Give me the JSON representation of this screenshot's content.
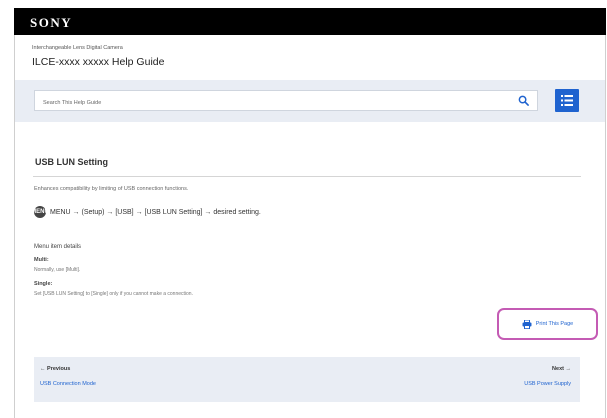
{
  "header": {
    "logo": "SONY"
  },
  "product": {
    "line": "Interchangeable Lens Digital Camera",
    "guide_title": "ILCE-xxxx xxxxx Help Guide"
  },
  "search": {
    "placeholder": "Search This Help Guide",
    "value": ""
  },
  "page": {
    "heading": "USB LUN Setting",
    "description": "Enhances compatibility by limiting of USB connection functions.",
    "menu_icon_label": "MENU",
    "menu_path": "MENU → (Setup) → [USB] → [USB LUN Setting] → desired setting."
  },
  "details": {
    "heading": "Menu item details",
    "options": [
      {
        "name": "Multi:",
        "desc": "Normally, use [Multi]."
      },
      {
        "name": "Single:",
        "desc": "Set [USB LUN Setting] to [Single] only if you cannot make a connection."
      }
    ]
  },
  "actions": {
    "print_label": "Print This Page"
  },
  "pagination": {
    "prev_label": "← Previous",
    "prev_link": "USB Connection Mode",
    "next_label": "Next →",
    "next_link": "USB Power Supply"
  },
  "colors": {
    "accent": "#1f63cf",
    "highlight": "#c45bb4",
    "band": "#e9edf4"
  }
}
